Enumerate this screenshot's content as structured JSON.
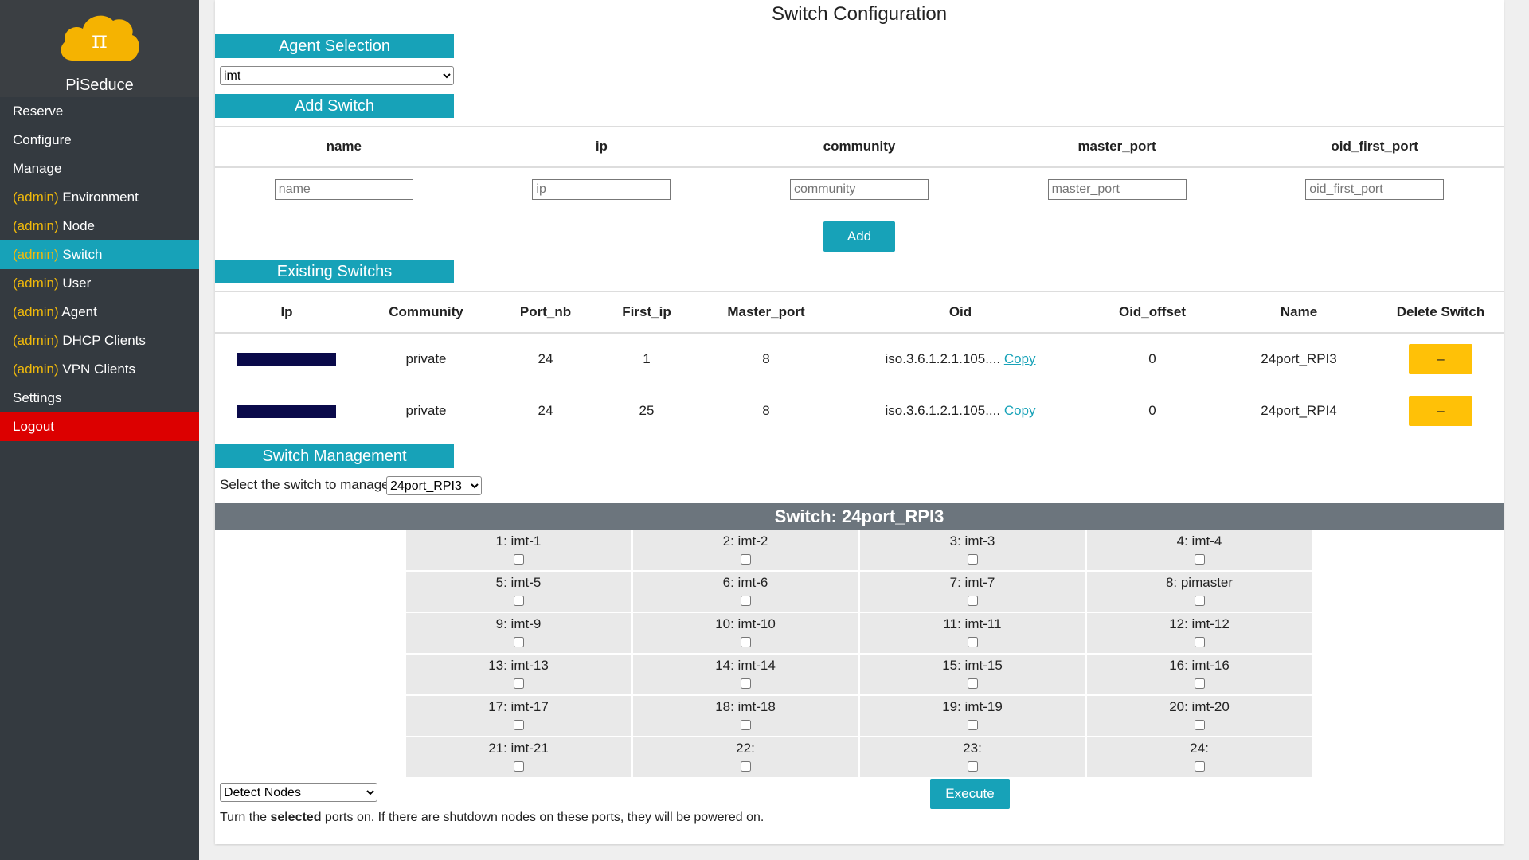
{
  "sidebar": {
    "brand": "PiSeduce",
    "logo_glyph": "π",
    "items": [
      {
        "prefix": "",
        "label": "Reserve"
      },
      {
        "prefix": "",
        "label": "Configure"
      },
      {
        "prefix": "",
        "label": "Manage"
      },
      {
        "prefix": "(admin)",
        "label": "Environment"
      },
      {
        "prefix": "(admin)",
        "label": "Node"
      },
      {
        "prefix": "(admin)",
        "label": "Switch"
      },
      {
        "prefix": "(admin)",
        "label": "User"
      },
      {
        "prefix": "(admin)",
        "label": "Agent"
      },
      {
        "prefix": "(admin)",
        "label": "DHCP Clients"
      },
      {
        "prefix": "(admin)",
        "label": "VPN Clients"
      },
      {
        "prefix": "",
        "label": "Settings"
      },
      {
        "prefix": "",
        "label": "Logout"
      }
    ]
  },
  "page": {
    "title": "Switch Configuration"
  },
  "agent": {
    "heading": "Agent Selection",
    "selected": "imt"
  },
  "add_switch": {
    "heading": "Add Switch",
    "columns": [
      "name",
      "ip",
      "community",
      "master_port",
      "oid_first_port"
    ],
    "placeholders": [
      "name",
      "ip",
      "community",
      "master_port",
      "oid_first_port"
    ],
    "button": "Add"
  },
  "existing": {
    "heading": "Existing Switchs",
    "columns": [
      "Ip",
      "Community",
      "Port_nb",
      "First_ip",
      "Master_port",
      "Oid",
      "Oid_offset",
      "Name",
      "Delete Switch"
    ],
    "rows": [
      {
        "community": "private",
        "port_nb": "24",
        "first_ip": "1",
        "master_port": "8",
        "oid": "iso.3.6.1.2.1.105....",
        "copy": "Copy",
        "oid_offset": "0",
        "name": "24port_RPI3",
        "delete": "–"
      },
      {
        "community": "private",
        "port_nb": "24",
        "first_ip": "25",
        "master_port": "8",
        "oid": "iso.3.6.1.2.1.105....",
        "copy": "Copy",
        "oid_offset": "0",
        "name": "24port_RPI4",
        "delete": "–"
      }
    ]
  },
  "management": {
    "heading": "Switch Management",
    "select_label": "Select the switch to manage:",
    "selected_switch": "24port_RPI3",
    "switch_title": "Switch: 24port_RPI3",
    "ports": [
      "1: imt-1",
      "2: imt-2",
      "3: imt-3",
      "4: imt-4",
      "5: imt-5",
      "6: imt-6",
      "7: imt-7",
      "8: pimaster",
      "9: imt-9",
      "10: imt-10",
      "11: imt-11",
      "12: imt-12",
      "13: imt-13",
      "14: imt-14",
      "15: imt-15",
      "16: imt-16",
      "17: imt-17",
      "18: imt-18",
      "19: imt-19",
      "20: imt-20",
      "21: imt-21",
      "22:",
      "23:",
      "24:"
    ],
    "action": "Detect Nodes",
    "execute": "Execute",
    "help": {
      "before": "Turn the ",
      "bold": "selected",
      "after": " ports on. If there are shutdown nodes on these ports, they will be powered on."
    }
  },
  "colors": {
    "accent": "#17a2b8",
    "warning": "#ffc107",
    "danger": "#dc0000",
    "sidebar": "#343a40",
    "admin_prefix": "#f0b90b"
  }
}
